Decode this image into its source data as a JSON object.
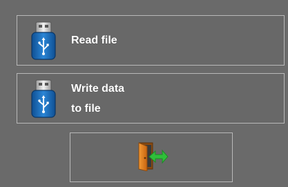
{
  "menu": {
    "read_file": {
      "label": "Read file",
      "icon": "usb-drive-icon"
    },
    "write_data": {
      "label_line1": "Write data",
      "label_line2": "to file",
      "icon": "usb-drive-icon"
    },
    "exit": {
      "icon": "exit-door-icon"
    }
  },
  "colors": {
    "background": "#6a6a6a",
    "button_border": "#b9b9b9",
    "label_text": "#ffffff",
    "usb_blue": "#1e6fc0",
    "door_orange": "#e07b1a",
    "arrow_green": "#2fbf3a"
  }
}
